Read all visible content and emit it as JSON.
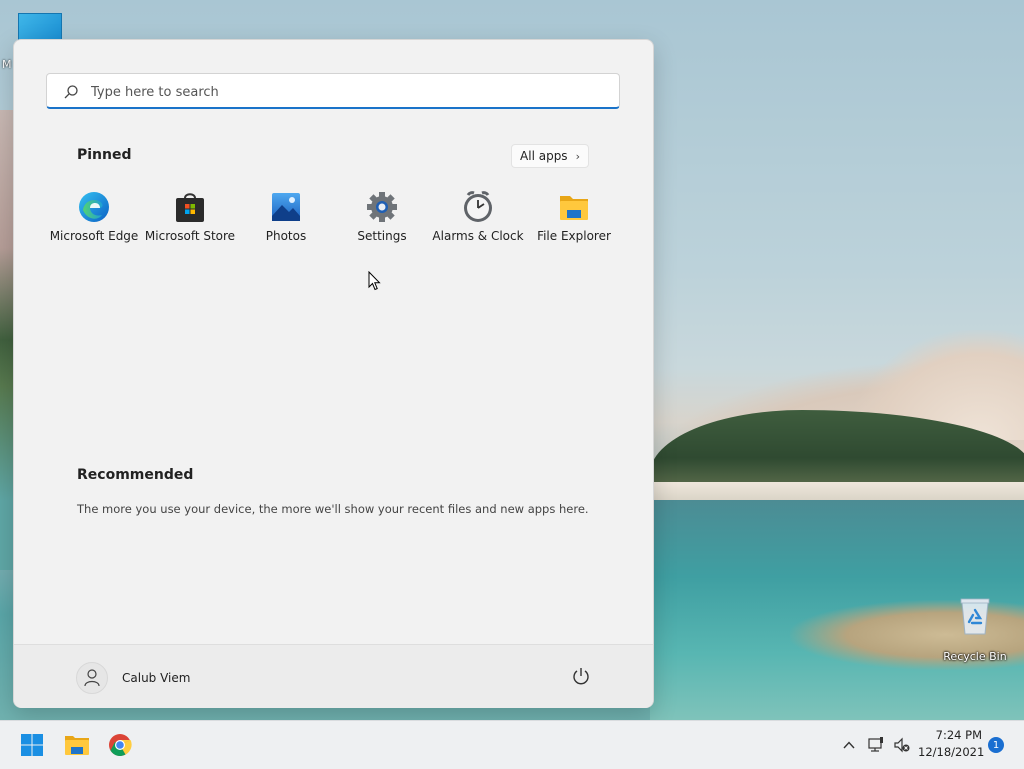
{
  "desktop": {
    "top_icon_label": "M",
    "recycle_bin_label": "Recycle Bin"
  },
  "start_menu": {
    "search": {
      "placeholder": "Type here to search",
      "value": ""
    },
    "pinned": {
      "title": "Pinned",
      "all_apps_label": "All apps",
      "apps": [
        {
          "label": "Microsoft Edge",
          "icon": "edge-icon"
        },
        {
          "label": "Microsoft Store",
          "icon": "store-icon"
        },
        {
          "label": "Photos",
          "icon": "photos-icon"
        },
        {
          "label": "Settings",
          "icon": "settings-gear-icon"
        },
        {
          "label": "Alarms & Clock",
          "icon": "alarm-clock-icon"
        },
        {
          "label": "File Explorer",
          "icon": "folder-icon"
        }
      ]
    },
    "recommended": {
      "title": "Recommended",
      "text": "The more you use your device, the more we'll show your recent files and new apps here."
    },
    "user": {
      "name": "Calub Viem"
    }
  },
  "taskbar": {
    "clock": {
      "time": "7:24 PM",
      "date": "12/18/2021"
    },
    "notification_count": "1",
    "colors": {
      "accent": "#1a73c9",
      "badge": "#1a6fd1"
    }
  }
}
